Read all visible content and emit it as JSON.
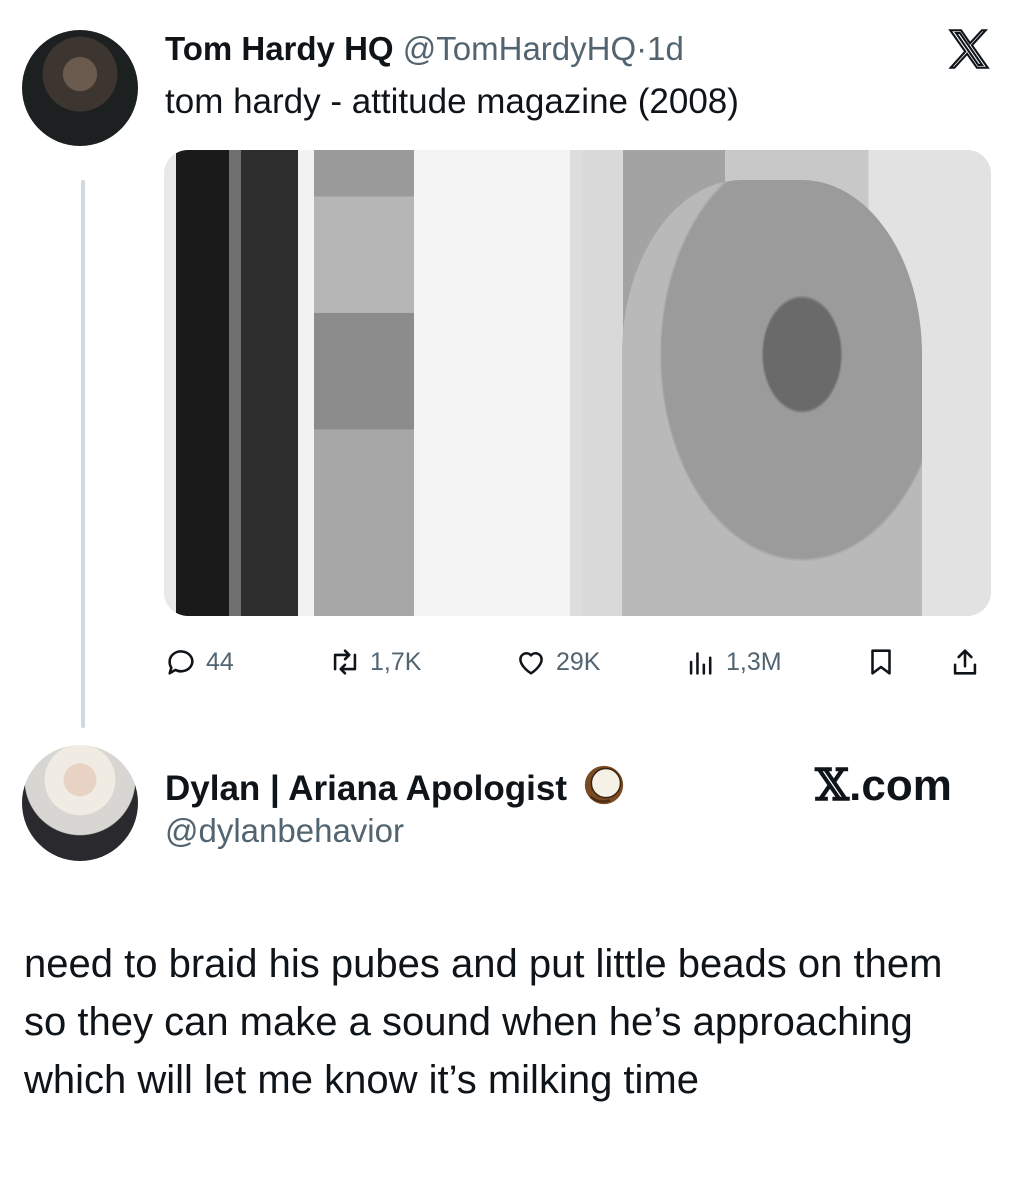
{
  "tweet1": {
    "display_name": "Tom Hardy HQ",
    "handle": "@TomHardyHQ",
    "separator": "·",
    "time": "1d",
    "text": "tom hardy - attitude magazine (2008)",
    "stats": {
      "replies": "44",
      "retweets": "1,7K",
      "likes": "29K",
      "views": "1,3M"
    }
  },
  "tweet2": {
    "display_name": "Dylan | Ariana Apologist",
    "name_emoji": "coconut-emoji",
    "handle": "@dylanbehavior",
    "text": "need to braid his pubes and put little beads on them so they can make a sound when he’s approaching which will let me know it’s milking time"
  },
  "watermark": {
    "x_glyph": "𝕏",
    "suffix": ".com"
  },
  "icons": [
    "x-logo-icon",
    "reply-icon",
    "retweet-icon",
    "like-icon",
    "views-icon",
    "bookmark-icon",
    "share-icon"
  ],
  "colors": {
    "text": "#0f1419",
    "secondary": "#536471",
    "thread_line": "#cfd9de"
  }
}
